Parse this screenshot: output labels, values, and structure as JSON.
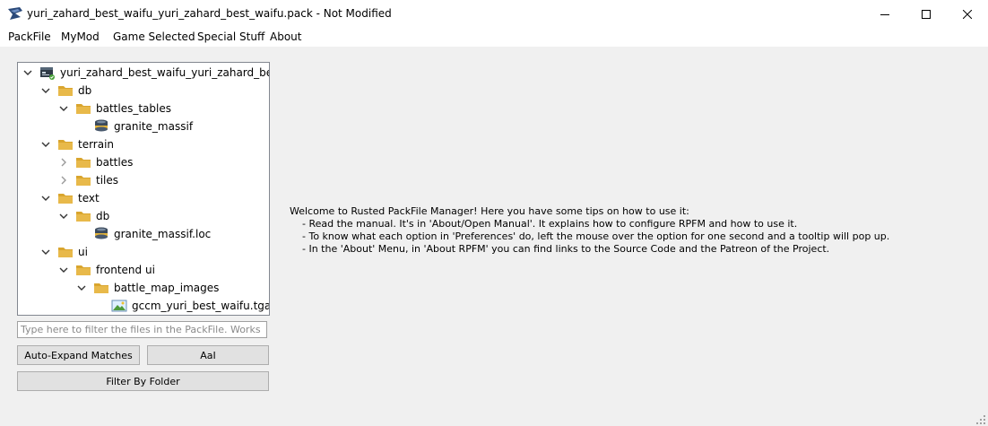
{
  "window": {
    "title": "yuri_zahard_best_waifu_yuri_zahard_best_waifu.pack - Not Modified"
  },
  "menubar": {
    "items": [
      "PackFile",
      "MyMod",
      "Game Selected",
      "Special Stuff",
      "About"
    ]
  },
  "tree": {
    "items": [
      {
        "label": "yuri_zahard_best_waifu_yuri_zahard_best_...",
        "icon": "packfile-icon",
        "arrow": "expanded"
      },
      {
        "label": "db",
        "icon": "folder-icon",
        "arrow": "expanded"
      },
      {
        "label": "battles_tables",
        "icon": "folder-icon",
        "arrow": "expanded"
      },
      {
        "label": "granite_massif",
        "icon": "database-icon",
        "arrow": "none"
      },
      {
        "label": "terrain",
        "icon": "folder-icon",
        "arrow": "expanded"
      },
      {
        "label": "battles",
        "icon": "folder-icon",
        "arrow": "collapsed"
      },
      {
        "label": "tiles",
        "icon": "folder-icon",
        "arrow": "collapsed"
      },
      {
        "label": "text",
        "icon": "folder-icon",
        "arrow": "expanded"
      },
      {
        "label": "db",
        "icon": "folder-icon",
        "arrow": "expanded"
      },
      {
        "label": "granite_massif.loc",
        "icon": "database-icon",
        "arrow": "none"
      },
      {
        "label": "ui",
        "icon": "folder-icon",
        "arrow": "expanded"
      },
      {
        "label": "frontend ui",
        "icon": "folder-icon",
        "arrow": "expanded"
      },
      {
        "label": "battle_map_images",
        "icon": "folder-icon",
        "arrow": "expanded"
      },
      {
        "label": "gccm_yuri_best_waifu.tga",
        "icon": "image-file-icon",
        "arrow": "none"
      }
    ]
  },
  "filter": {
    "placeholder": "Type here to filter the files in the PackFile. Works with Regex too!",
    "value": ""
  },
  "buttons": {
    "auto_expand": "Auto-Expand Matches",
    "case_sensitive": "AaI",
    "filter_by_folder": "Filter By Folder"
  },
  "welcome": {
    "intro": "Welcome to Rusted PackFile Manager! Here you have some tips on how to use it:",
    "tips": [
      "- Read the manual. It's in 'About/Open Manual'. It explains how to configure RPFM and how to use it.",
      "- To know what each option in 'Preferences' do, left the mouse over the option for one second and a tooltip will pop up.",
      "- In the 'About' Menu, in 'About RPFM' you can find links to the Source Code and the Patreon of the Project."
    ]
  },
  "colors": {
    "folder": "#e8b94a",
    "folder_dark": "#d9a52e",
    "background": "#f0f0f0",
    "tree_border": "#828790"
  }
}
